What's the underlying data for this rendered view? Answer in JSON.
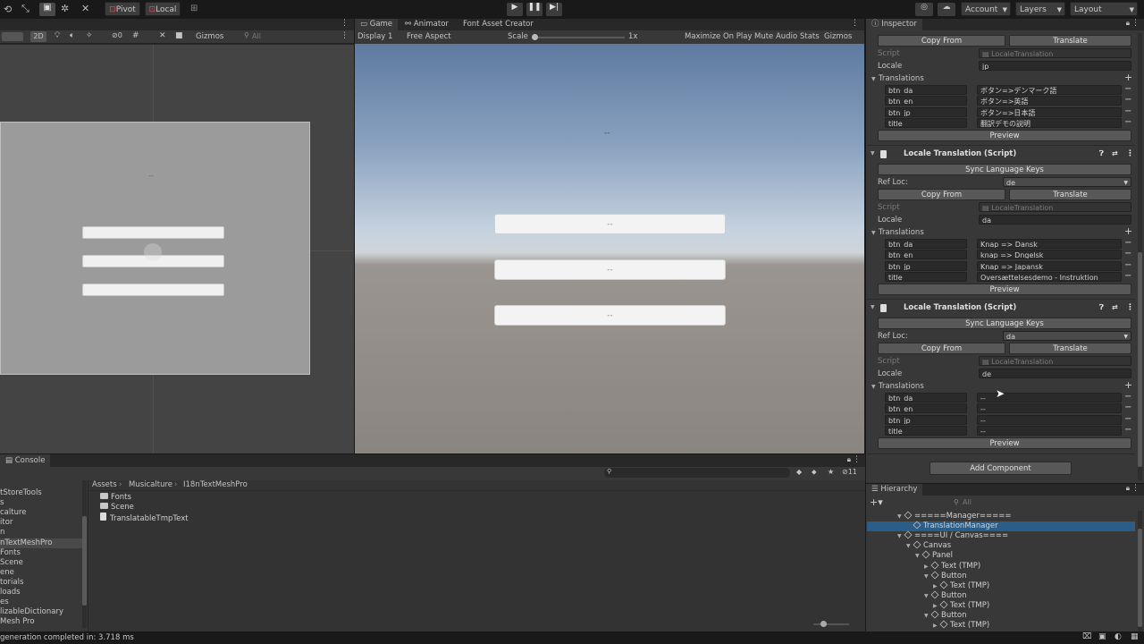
{
  "toolbar": {
    "pivot_label": "Pivot",
    "local_label": "Local",
    "account_label": "Account",
    "layers_label": "Layers",
    "layout_label": "Layout"
  },
  "scene_view": {
    "mode_2d": "2D",
    "gizmos_label": "Gizmos",
    "search_placeholder": "All",
    "hidden_count": "0",
    "canvas_title": "--",
    "buttons": [
      "",
      "",
      ""
    ]
  },
  "game_view": {
    "tabs": [
      "Game",
      "Animator",
      "Font Asset Creator"
    ],
    "display": "Display 1",
    "aspect": "Free Aspect",
    "scale_label": "Scale",
    "scale_value": "1x",
    "maximize_label": "Maximize On Play",
    "mute_label": "Mute Audio",
    "stats_label": "Stats",
    "gizmos_label": "Gizmos",
    "title_text": "--",
    "buttons": [
      "--",
      "--",
      "--"
    ]
  },
  "inspector": {
    "tab_label": "Inspector",
    "top": {
      "copy_from": "Copy From",
      "translate": "Translate",
      "script_label": "Script",
      "script_value": "LocaleTranslation",
      "locale_label": "Locale",
      "locale_value": "jp",
      "translations_label": "Translations",
      "rows": [
        {
          "key": "btn_da",
          "value": "ボタン=>デンマーク語"
        },
        {
          "key": "btn_en",
          "value": "ボタン=>英語"
        },
        {
          "key": "btn_jp",
          "value": "ボタン=>日本語"
        },
        {
          "key": "title",
          "value": "翻訳デモの説明"
        }
      ],
      "preview": "Preview"
    },
    "components": [
      {
        "header": "Locale Translation (Script)",
        "sync": "Sync Language Keys",
        "ref_loc_label": "Ref Loc:",
        "ref_loc_value": "de",
        "copy_from": "Copy From",
        "translate": "Translate",
        "script_label": "Script",
        "script_value": "LocaleTranslation",
        "locale_label": "Locale",
        "locale_value": "da",
        "translations_label": "Translations",
        "rows": [
          {
            "key": "btn_da",
            "value": "Knap => Dansk"
          },
          {
            "key": "btn_en",
            "value": "knap => Dngelsk"
          },
          {
            "key": "btn_jp",
            "value": "Knap => Japansk"
          },
          {
            "key": "title",
            "value": "Oversættelsesdemo - Instruktion"
          }
        ],
        "preview": "Preview"
      },
      {
        "header": "Locale Translation (Script)",
        "sync": "Sync Language Keys",
        "ref_loc_label": "Ref Loc:",
        "ref_loc_value": "da",
        "copy_from": "Copy From",
        "translate": "Translate",
        "script_label": "Script",
        "script_value": "LocaleTranslation",
        "locale_label": "Locale",
        "locale_value": "de",
        "translations_label": "Translations",
        "rows": [
          {
            "key": "btn_da",
            "value": "--"
          },
          {
            "key": "btn_en",
            "value": "--"
          },
          {
            "key": "btn_jp",
            "value": "--"
          },
          {
            "key": "title",
            "value": "--"
          }
        ],
        "preview": "Preview"
      }
    ],
    "add_component": "Add Component"
  },
  "hierarchy": {
    "tab_label": "Hierarchy",
    "search_placeholder": "All",
    "items": [
      {
        "label": "=====Manager=====",
        "indent": 0,
        "selected": false,
        "expanded": true
      },
      {
        "label": "TranslationManager",
        "indent": 1,
        "selected": true,
        "expanded": null
      },
      {
        "label": "====UI / Canvas====",
        "indent": 0,
        "selected": false,
        "expanded": true
      },
      {
        "label": "Canvas",
        "indent": 1,
        "selected": false,
        "expanded": true
      },
      {
        "label": "Panel",
        "indent": 2,
        "selected": false,
        "expanded": true
      },
      {
        "label": "Text (TMP)",
        "indent": 3,
        "selected": false,
        "expanded": false
      },
      {
        "label": "Button",
        "indent": 3,
        "selected": false,
        "expanded": true
      },
      {
        "label": "Text (TMP)",
        "indent": 4,
        "selected": false,
        "expanded": false
      },
      {
        "label": "Button",
        "indent": 3,
        "selected": false,
        "expanded": true
      },
      {
        "label": "Text (TMP)",
        "indent": 4,
        "selected": false,
        "expanded": false
      },
      {
        "label": "Button",
        "indent": 3,
        "selected": false,
        "expanded": true
      },
      {
        "label": "Text (TMP)",
        "indent": 4,
        "selected": false,
        "expanded": false
      }
    ]
  },
  "console": {
    "tab_label": "Console",
    "badge_count": "11"
  },
  "project": {
    "breadcrumb": [
      "Assets",
      "Musicalture",
      "I18nTextMeshPro"
    ],
    "tree": [
      "tStoreTools",
      "s",
      "calture",
      "itor",
      "n",
      "nTextMeshPro",
      "Fonts",
      "Scene",
      "ene",
      "torials",
      "loads",
      "es",
      "lizableDictionary",
      "Mesh Pro"
    ],
    "assets": [
      {
        "name": "Fonts",
        "kind": "folder"
      },
      {
        "name": "Scene",
        "kind": "folder"
      },
      {
        "name": "TranslatableTmpText",
        "kind": "script"
      }
    ]
  },
  "status": {
    "message": "generation completed in: 3.718 ms"
  }
}
